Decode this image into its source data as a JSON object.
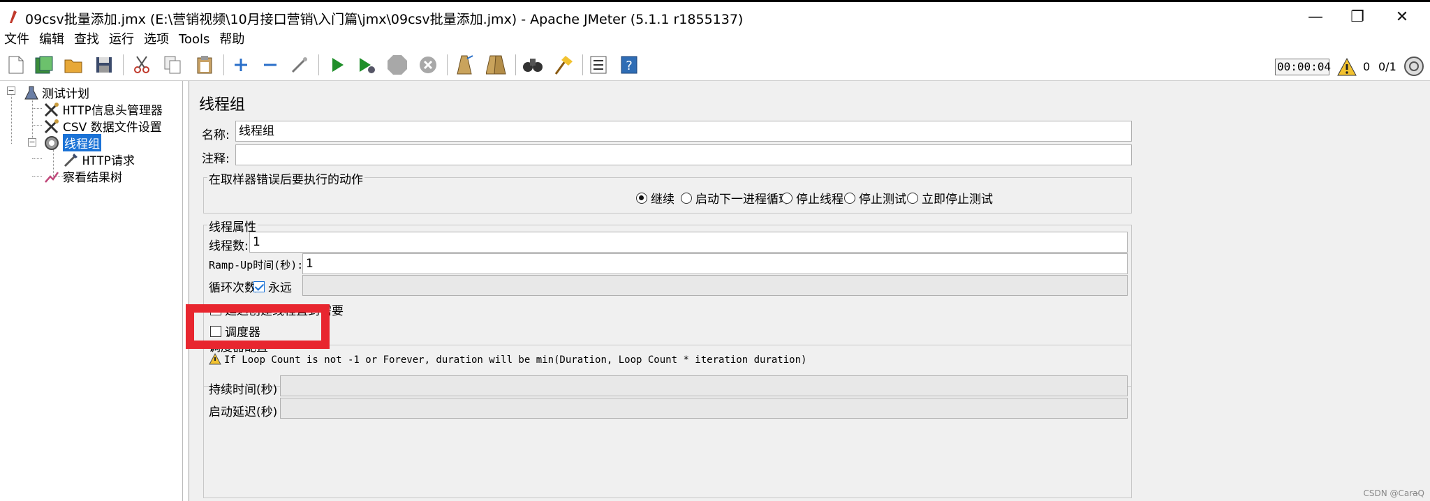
{
  "window": {
    "title": "09csv批量添加.jmx (E:\\营销视频\\10月接口营销\\入门篇\\jmx\\09csv批量添加.jmx) - Apache JMeter (5.1.1 r1855137)",
    "minimize": "—",
    "maximize": "❐",
    "close": "✕"
  },
  "menu": [
    "文件",
    "编辑",
    "查找",
    "运行",
    "选项",
    "Tools",
    "帮助"
  ],
  "toolbar": {
    "icons": [
      "new-icon",
      "templates-icon",
      "open-icon",
      "save-icon",
      "cut-icon",
      "copy-icon",
      "paste-icon",
      "expand-icon",
      "collapse-icon",
      "toggle-icon",
      "start-icon",
      "start-no-pause-icon",
      "stop-icon",
      "shutdown-icon",
      "clear-icon",
      "clear-all-icon",
      "search-icon",
      "reset-search-icon",
      "function-helper-icon",
      "help-icon"
    ],
    "timer": "00:00:04",
    "warn_count": "0",
    "thread_count": "0/1"
  },
  "tree": {
    "root": "测试计划",
    "header_manager": "HTTP信息头管理器",
    "csv_config": "CSV 数据文件设置",
    "thread_group": "线程组",
    "http_request": "HTTP请求",
    "result_tree": "察看结果树"
  },
  "panel": {
    "title": "线程组",
    "name_label": "名称:",
    "name_value": "线程组",
    "comment_label": "注释:",
    "comment_value": "",
    "error_action": {
      "title": "在取样器错误后要执行的动作",
      "options": [
        "继续",
        "启动下一进程循环",
        "停止线程",
        "停止测试",
        "立即停止测试"
      ],
      "selected": "继续"
    },
    "thread_props": {
      "title": "线程属性",
      "threads_label": "线程数:",
      "threads_value": "1",
      "rampup_label": "Ramp-Up时间(秒):",
      "rampup_value": "1",
      "loop_label": "循环次数",
      "forever_label": "永远",
      "forever_checked": true,
      "delay_label": "延迟创建线程直到需要",
      "scheduler_label": "调度器"
    },
    "scheduler": {
      "title": "调度器配置",
      "warning": "If Loop Count is not -1 or Forever, duration will be min(Duration, Loop Count * iteration duration)",
      "duration_label": "持续时间(秒)",
      "delay_label": "启动延迟(秒)"
    }
  },
  "watermark": "CSDN @Cara̶Q",
  "colors": {
    "highlight": "#e8262f",
    "selection": "#1a72d6"
  }
}
